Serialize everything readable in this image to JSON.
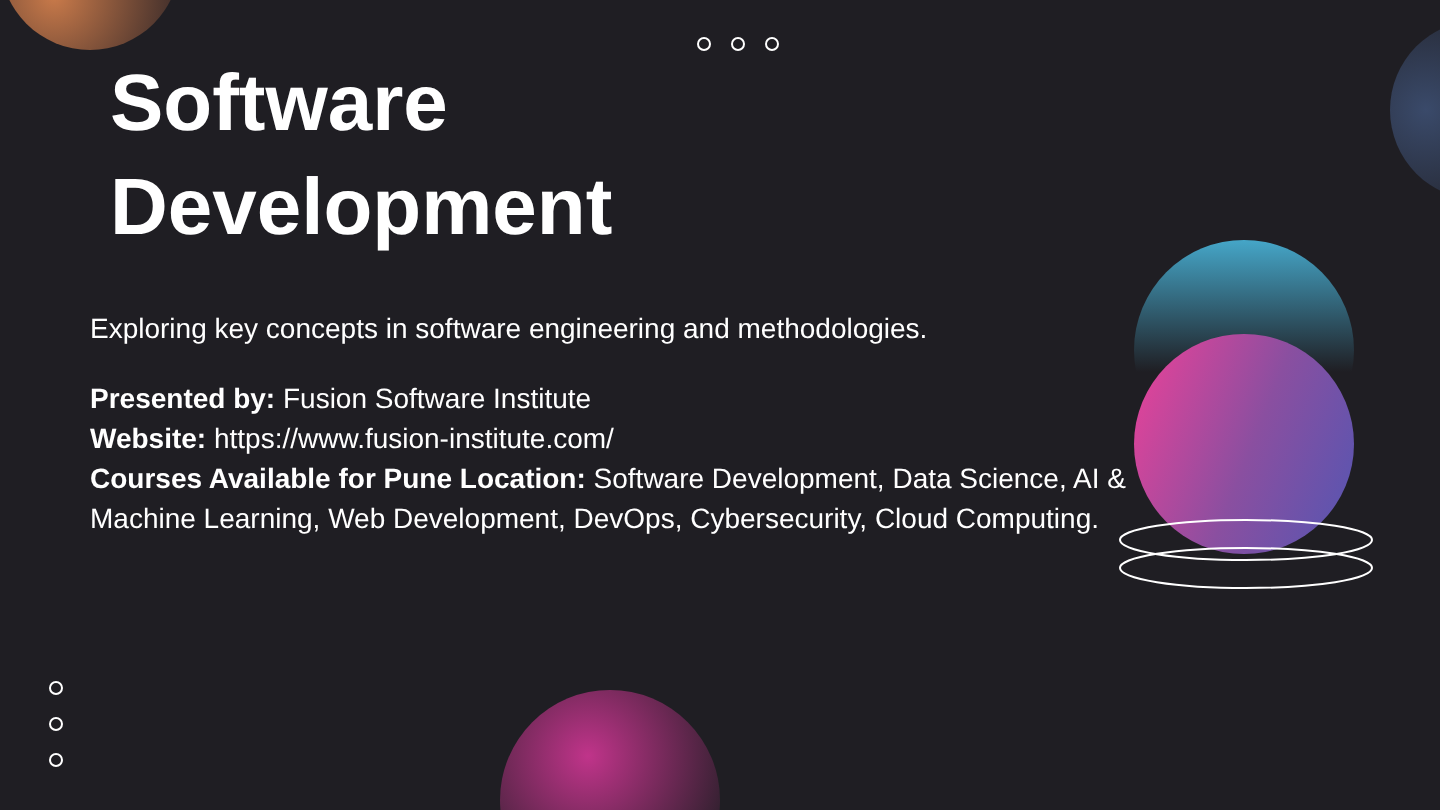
{
  "title": "Software Development",
  "subtitle": "Exploring key concepts in software engineering and methodologies.",
  "details": [
    {
      "label": "Presented by:",
      "value": "Fusion Software Institute"
    },
    {
      "label": "Website:",
      "value": "https://www.fusion-institute.com/"
    },
    {
      "label": "Courses Available for Pune Location:",
      "value": "Software Development, Data Science, AI & Machine Learning, Web Development, DevOps, Cybersecurity, Cloud Computing."
    }
  ]
}
